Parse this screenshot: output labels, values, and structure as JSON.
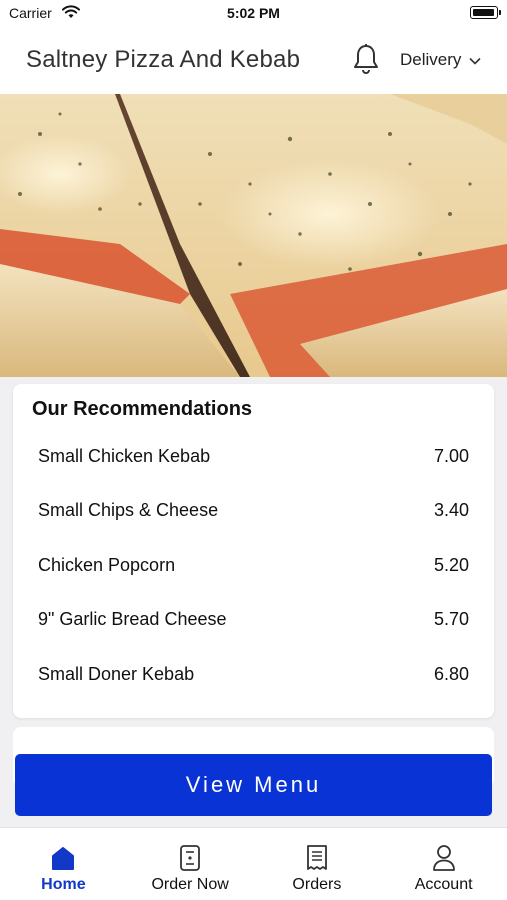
{
  "status_bar": {
    "carrier": "Carrier",
    "time": "5:02 PM"
  },
  "header": {
    "title": "Saltney Pizza And Kebab",
    "delivery_label": "Delivery"
  },
  "hero": {
    "image": "pizza-slices-photo"
  },
  "recommendations": {
    "title": "Our Recommendations",
    "items": [
      {
        "name": "Small Chicken Kebab",
        "price": "7.00"
      },
      {
        "name": "Small Chips & Cheese",
        "price": "3.40"
      },
      {
        "name": "Chicken Popcorn",
        "price": "5.20"
      },
      {
        "name": "9\" Garlic Bread Cheese",
        "price": "5.70"
      },
      {
        "name": "Small Doner Kebab",
        "price": "6.80"
      }
    ]
  },
  "view_menu_label": "View Menu",
  "tabs": [
    {
      "label": "Home",
      "icon": "home-icon",
      "active": true
    },
    {
      "label": "Order Now",
      "icon": "menu-card-icon",
      "active": false
    },
    {
      "label": "Orders",
      "icon": "receipt-icon",
      "active": false
    },
    {
      "label": "Account",
      "icon": "user-icon",
      "active": false
    }
  ],
  "colors": {
    "accent": "#0a33d6",
    "active_tab": "#1238c8"
  }
}
